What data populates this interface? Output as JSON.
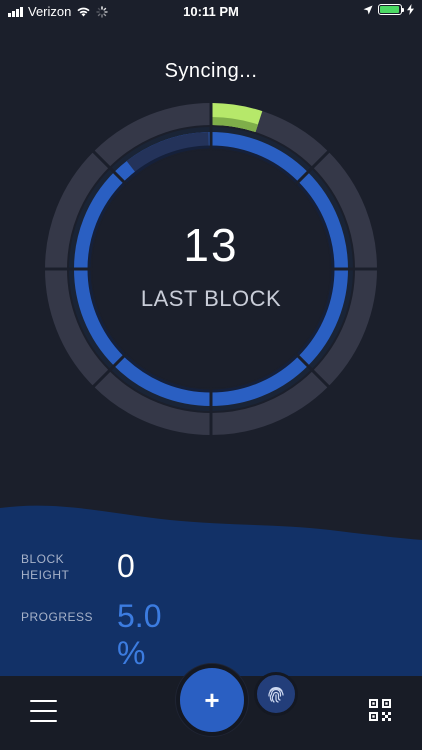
{
  "status_bar": {
    "carrier": "Verizon",
    "time": "10:11 PM",
    "battery_percent": 95
  },
  "title": "Syncing...",
  "ring": {
    "block_number": "13",
    "label": "LAST BLOCK",
    "progress_percent": 5.0
  },
  "stats": {
    "block_height_label": "BLOCK\nHEIGHT",
    "block_height_value": "0",
    "progress_label": "PROGRESS",
    "progress_value": "5.0 %"
  },
  "colors": {
    "background": "#1b1f2b",
    "accent_blue": "#2a5fc2",
    "progress_green": "#b6e86a",
    "progress_text": "#3c7ce0",
    "wave": "#123167"
  },
  "icons": {
    "menu": "hamburger-icon",
    "add": "plus-icon",
    "fingerprint": "fingerprint-icon",
    "qr": "qr-code-icon"
  }
}
